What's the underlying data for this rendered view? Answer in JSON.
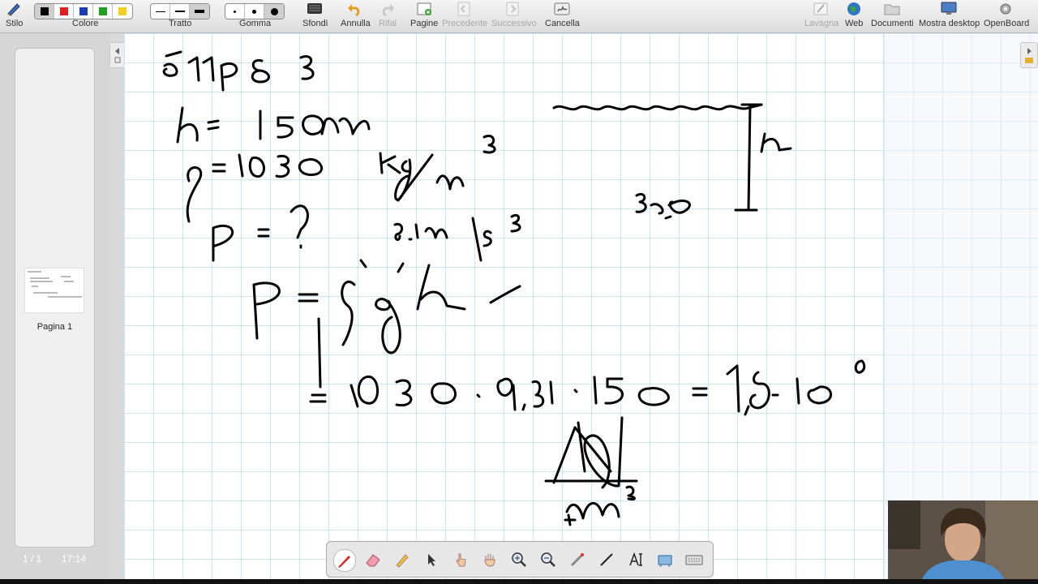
{
  "toolbar": {
    "stilo": "Stilo",
    "colore": "Colore",
    "tratto": "Tratto",
    "gomma": "Gomma",
    "sfondi": "Sfondi",
    "annulla": "Annulla",
    "rifai": "Rifai",
    "pagine": "Pagine",
    "precedente": "Precedente",
    "successivo": "Successivo",
    "cancella": "Cancella",
    "lavagna": "Lavagna",
    "web": "Web",
    "documenti": "Documenti",
    "mostra_desktop": "Mostra desktop",
    "openboard": "OpenBoard",
    "colors": [
      "#000000",
      "#e02020",
      "#1a3fb0",
      "#20a020",
      "#f5d020"
    ]
  },
  "sidebar": {
    "page_label": "Pagina 1",
    "page_count": "1 / 1",
    "time": "17:14"
  },
  "dock": {
    "tools": [
      "pen-icon",
      "eraser-icon",
      "marker-icon",
      "selector-icon",
      "play-icon",
      "hand-icon",
      "zoom-in-icon",
      "zoom-out-icon",
      "pointer-icon",
      "line-icon",
      "text-icon",
      "capture-icon",
      "keyboard-icon"
    ]
  }
}
